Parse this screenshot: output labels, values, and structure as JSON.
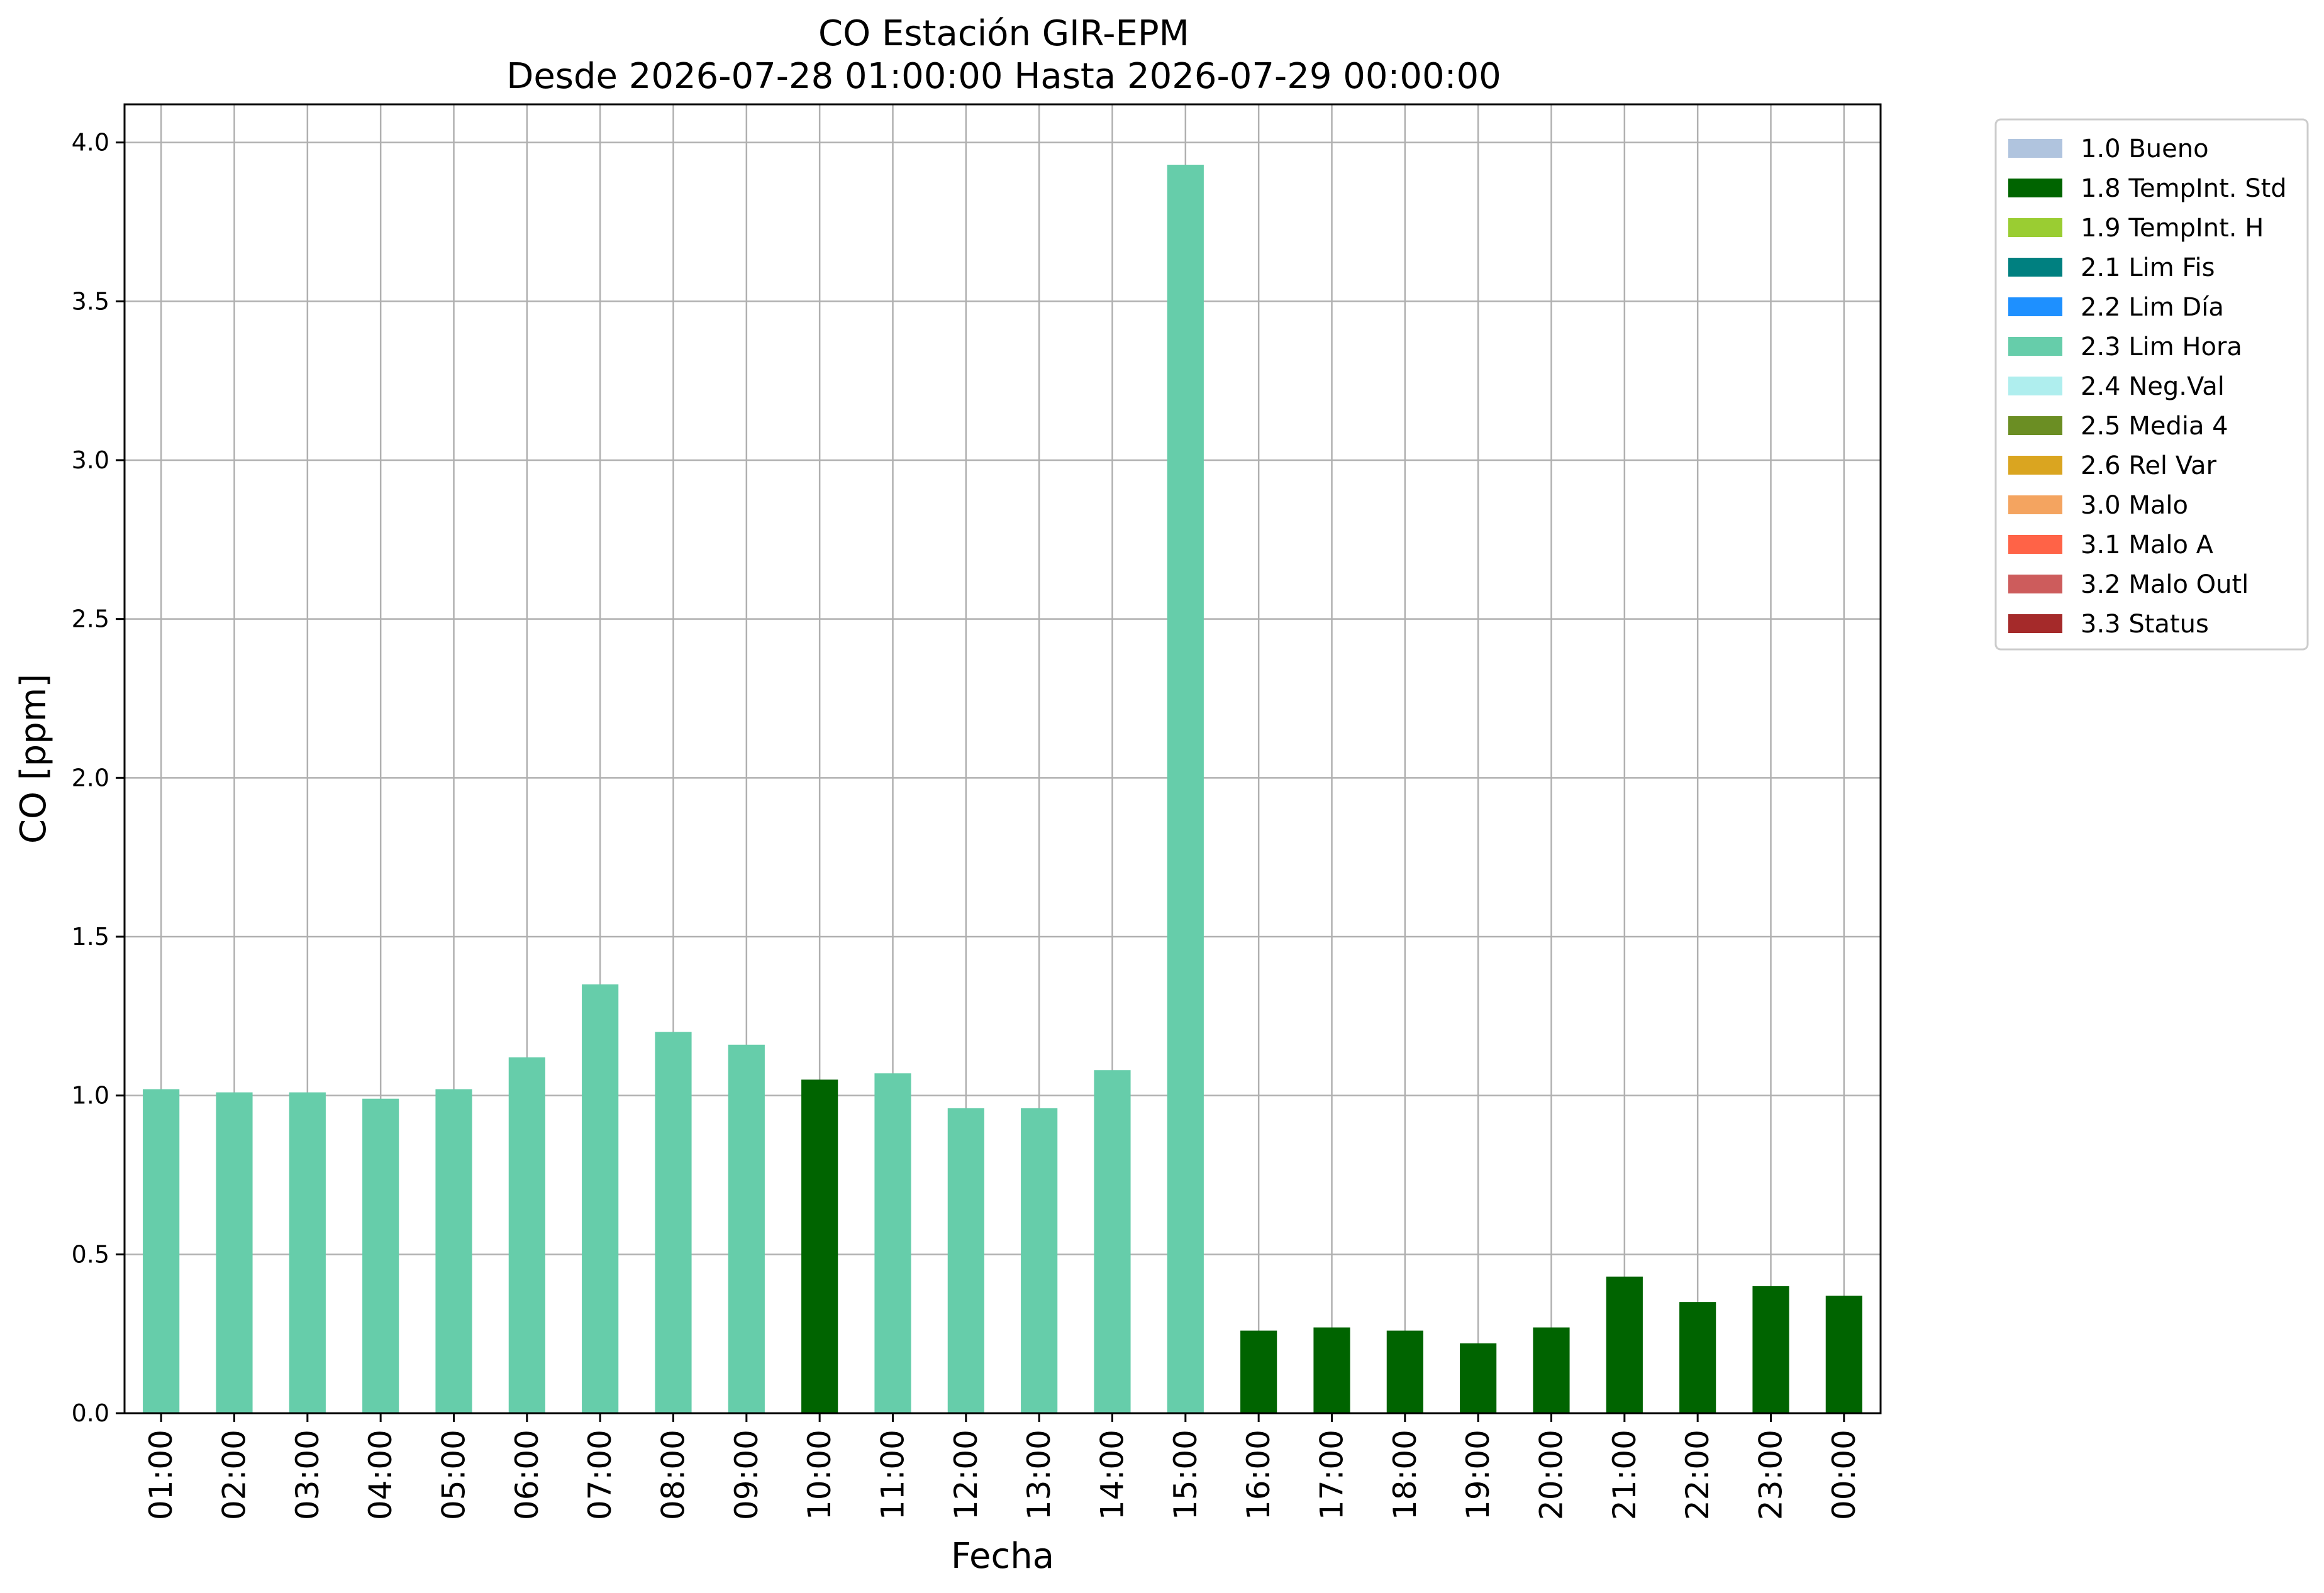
{
  "chart_data": {
    "type": "bar",
    "title": "CO Estación GIR-EPM",
    "subtitle": "Desde 2026-07-28 01:00:00 Hasta 2026-07-29 00:00:00",
    "xlabel": "Fecha",
    "ylabel": "CO [ppm]",
    "ylim": [
      0,
      4.12
    ],
    "yticks": [
      "0.0",
      "0.5",
      "1.0",
      "1.5",
      "2.0",
      "2.5",
      "3.0",
      "3.5",
      "4.0"
    ],
    "grid": true,
    "legend_position": "outside-top-right",
    "categories": [
      "01:00",
      "02:00",
      "03:00",
      "04:00",
      "05:00",
      "06:00",
      "07:00",
      "08:00",
      "09:00",
      "10:00",
      "11:00",
      "12:00",
      "13:00",
      "14:00",
      "15:00",
      "16:00",
      "17:00",
      "18:00",
      "19:00",
      "20:00",
      "21:00",
      "22:00",
      "23:00",
      "00:00"
    ],
    "values": [
      1.02,
      1.01,
      1.01,
      0.99,
      1.02,
      1.12,
      1.35,
      1.2,
      1.16,
      1.05,
      1.07,
      0.96,
      0.96,
      1.08,
      3.93,
      0.26,
      0.27,
      0.26,
      0.22,
      0.27,
      0.43,
      0.35,
      0.4,
      0.37
    ],
    "flags": [
      "2.3 Lim Hora",
      "2.3 Lim Hora",
      "2.3 Lim Hora",
      "2.3 Lim Hora",
      "2.3 Lim Hora",
      "2.3 Lim Hora",
      "2.3 Lim Hora",
      "2.3 Lim Hora",
      "2.3 Lim Hora",
      "1.8 TempInt. Std",
      "2.3 Lim Hora",
      "2.3 Lim Hora",
      "2.3 Lim Hora",
      "2.3 Lim Hora",
      "2.3 Lim Hora",
      "1.8 TempInt. Std",
      "1.8 TempInt. Std",
      "1.8 TempInt. Std",
      "1.8 TempInt. Std",
      "1.8 TempInt. Std",
      "1.8 TempInt. Std",
      "1.8 TempInt. Std",
      "1.8 TempInt. Std",
      "1.8 TempInt. Std"
    ],
    "legend": [
      {
        "name": "1.0 Bueno",
        "color": "#b0c4de"
      },
      {
        "name": "1.8 TempInt. Std",
        "color": "#006400"
      },
      {
        "name": "1.9 TempInt. H",
        "color": "#9acd32"
      },
      {
        "name": "2.1 Lim Fis",
        "color": "#008080"
      },
      {
        "name": "2.2 Lim Día",
        "color": "#1e90ff"
      },
      {
        "name": "2.3 Lim Hora",
        "color": "#66cdaa"
      },
      {
        "name": "2.4 Neg.Val",
        "color": "#afeeee"
      },
      {
        "name": "2.5 Media 4",
        "color": "#6b8e23"
      },
      {
        "name": "2.6 Rel Var",
        "color": "#daa520"
      },
      {
        "name": "3.0 Malo",
        "color": "#f4a460"
      },
      {
        "name": "3.1 Malo A",
        "color": "#ff6347"
      },
      {
        "name": "3.2 Malo Outl",
        "color": "#cd5c5c"
      },
      {
        "name": "3.3 Status",
        "color": "#a52a2a"
      }
    ]
  }
}
